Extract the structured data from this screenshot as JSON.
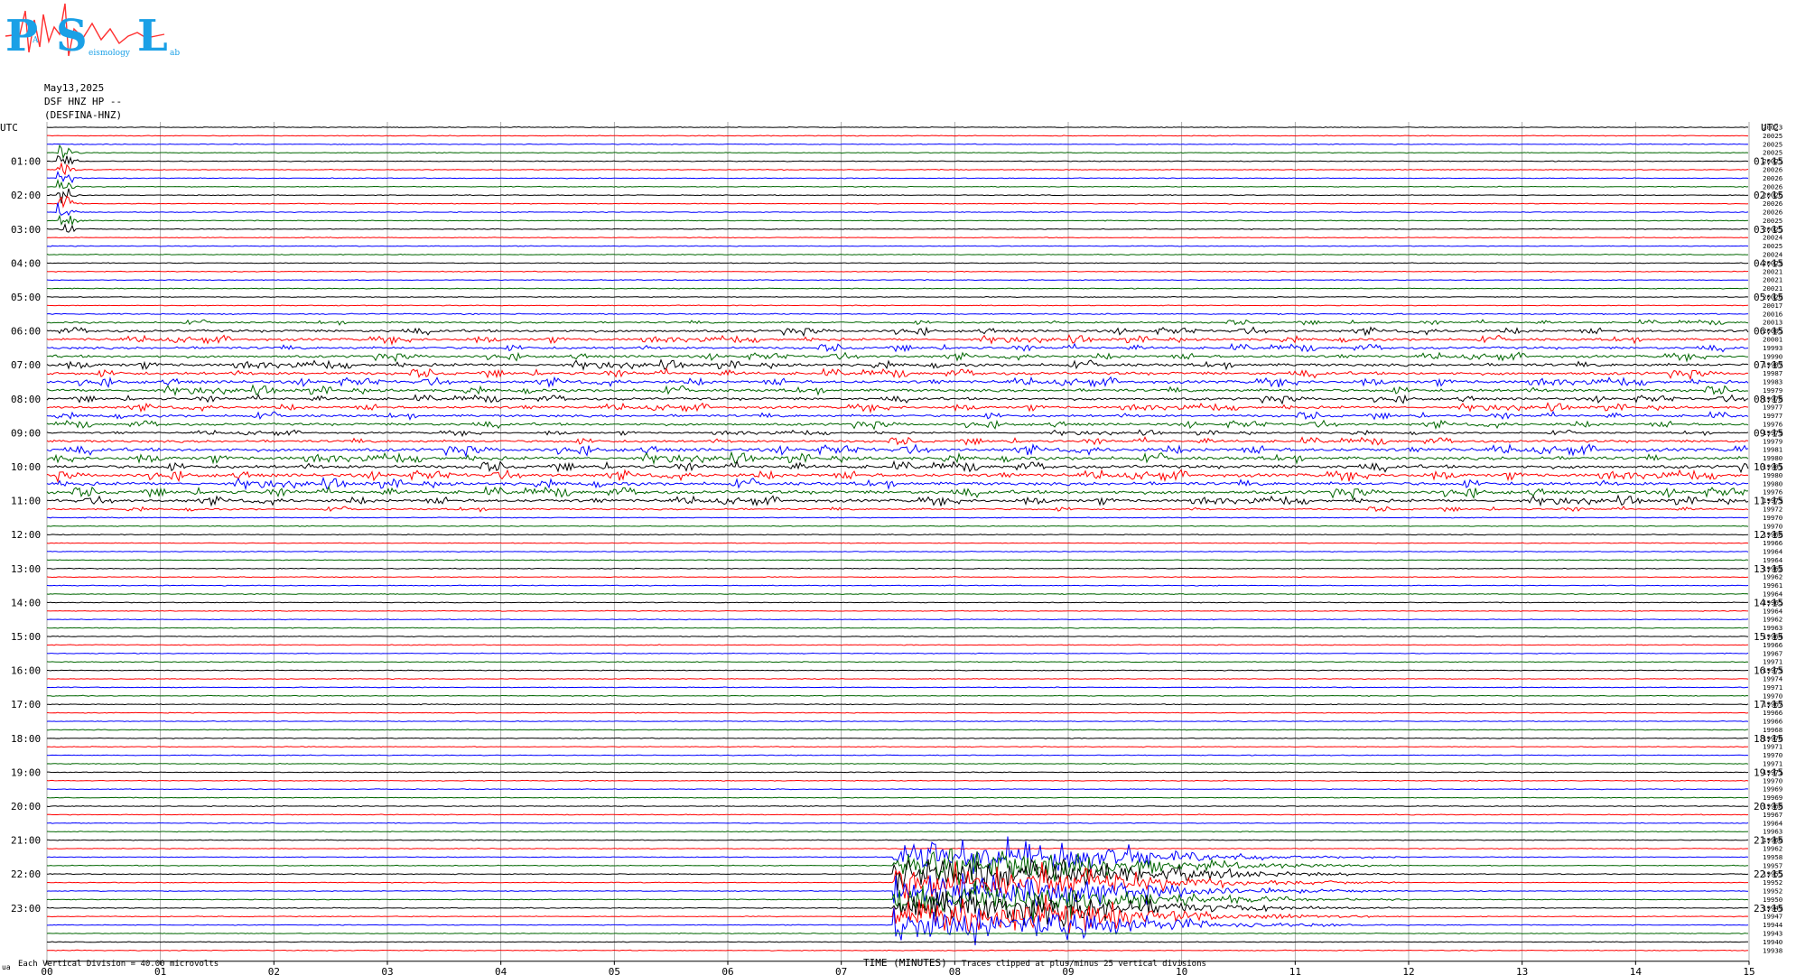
{
  "header": {
    "logo": {
      "letters": [
        "P",
        "S",
        "L"
      ],
      "small_text": [
        "A",
        "eismology",
        "ab"
      ],
      "colors": {
        "letters": "#1aa0e6",
        "wave": "#ff3030"
      }
    },
    "date": "May13,2025",
    "station": "DSF HNZ HP --",
    "name": "(DESFINA-HNZ)"
  },
  "footer": {
    "scale_prefix": "ua",
    "scale_note": "Each Vertical Division =   40.00 microvolts",
    "clip_note": "Traces clipped at plus/minus 25 vertical divisions"
  },
  "chart_data": {
    "type": "line",
    "title": "",
    "xlabel": "TIME (MINUTES)",
    "ylabel": "UTC",
    "right_axis_label": "UTC",
    "xlim": [
      0,
      15
    ],
    "x_ticks": [
      "00",
      "01",
      "02",
      "03",
      "04",
      "05",
      "06",
      "07",
      "08",
      "09",
      "10",
      "11",
      "12",
      "13",
      "14",
      "15"
    ],
    "trace_colors": [
      "#000000",
      "#ff0000",
      "#0000ff",
      "#006600"
    ],
    "grid": true,
    "left_hour_labels": [
      "01:00",
      "02:00",
      "03:00",
      "04:00",
      "05:00",
      "06:00",
      "07:00",
      "08:00",
      "09:00",
      "10:00",
      "11:00",
      "12:00",
      "13:00",
      "14:00",
      "15:00",
      "16:00",
      "17:00",
      "18:00",
      "19:00",
      "20:00",
      "21:00",
      "22:00",
      "23:00"
    ],
    "right_hour_labels": [
      "01:15",
      "02:15",
      "03:15",
      "04:15",
      "05:15",
      "06:15",
      "07:15",
      "08:15",
      "09:15",
      "10:15",
      "11:15",
      "12:15",
      "13:15",
      "14:15",
      "15:15",
      "16:15",
      "17:15",
      "18:15",
      "19:15",
      "20:15",
      "21:15",
      "22:15",
      "23:15"
    ],
    "trace_offsets": [
      20023,
      20025,
      20025,
      20025,
      20025,
      20026,
      20026,
      20026,
      20026,
      20026,
      20026,
      20025,
      20025,
      20024,
      20025,
      20024,
      20023,
      20021,
      20021,
      20021,
      20020,
      20017,
      20016,
      20013,
      20005,
      20001,
      19993,
      19990,
      19987,
      19987,
      19983,
      19979,
      19978,
      19977,
      19977,
      19976,
      19979,
      19979,
      19981,
      19980,
      19981,
      19980,
      19980,
      19976,
      19973,
      19972,
      19970,
      19970,
      19968,
      19966,
      19964,
      19964,
      19962,
      19962,
      19961,
      19964,
      19965,
      19964,
      19962,
      19963,
      19964,
      19966,
      19967,
      19971,
      19973,
      19974,
      19971,
      19970,
      19967,
      19966,
      19966,
      19968,
      19970,
      19971,
      19970,
      19971,
      19971,
      19970,
      19969,
      19969,
      19968,
      19967,
      19964,
      19963,
      19960,
      19962,
      19958,
      19957,
      19955,
      19952,
      19952,
      19950,
      19949,
      19947,
      19944,
      19943,
      19940,
      19938
    ],
    "trace_amplitude_level": [
      1,
      1,
      1,
      1,
      1,
      1,
      1,
      1,
      1,
      1,
      1,
      1,
      1,
      1,
      1,
      1,
      1,
      1,
      1,
      1,
      1,
      1,
      1.5,
      2,
      3,
      3,
      3,
      3,
      3.5,
      3.5,
      3.5,
      3.5,
      3,
      3,
      3,
      3,
      2,
      3,
      4,
      4,
      4,
      4,
      4,
      4,
      3.5,
      2,
      1,
      1,
      1,
      1,
      1,
      1,
      1,
      1,
      1,
      1,
      1,
      1,
      1,
      1,
      1,
      1,
      1,
      1,
      1,
      1,
      1,
      1,
      1,
      1,
      1,
      1,
      1,
      1,
      1,
      1,
      1,
      1,
      1,
      1,
      1,
      1,
      1,
      1,
      1,
      1,
      1,
      1,
      1,
      1,
      1,
      1,
      1,
      1,
      1,
      1,
      1,
      1
    ],
    "events": [
      {
        "label": "",
        "start_min": 0.08,
        "end_min": 0.35,
        "rows": [
          3,
          12
        ],
        "peak_divisions": 12
      },
      {
        "label": "",
        "start_min": 7.45,
        "end_min": 12.0,
        "rows": [
          86,
          94
        ],
        "peak_divisions": 25
      }
    ]
  }
}
